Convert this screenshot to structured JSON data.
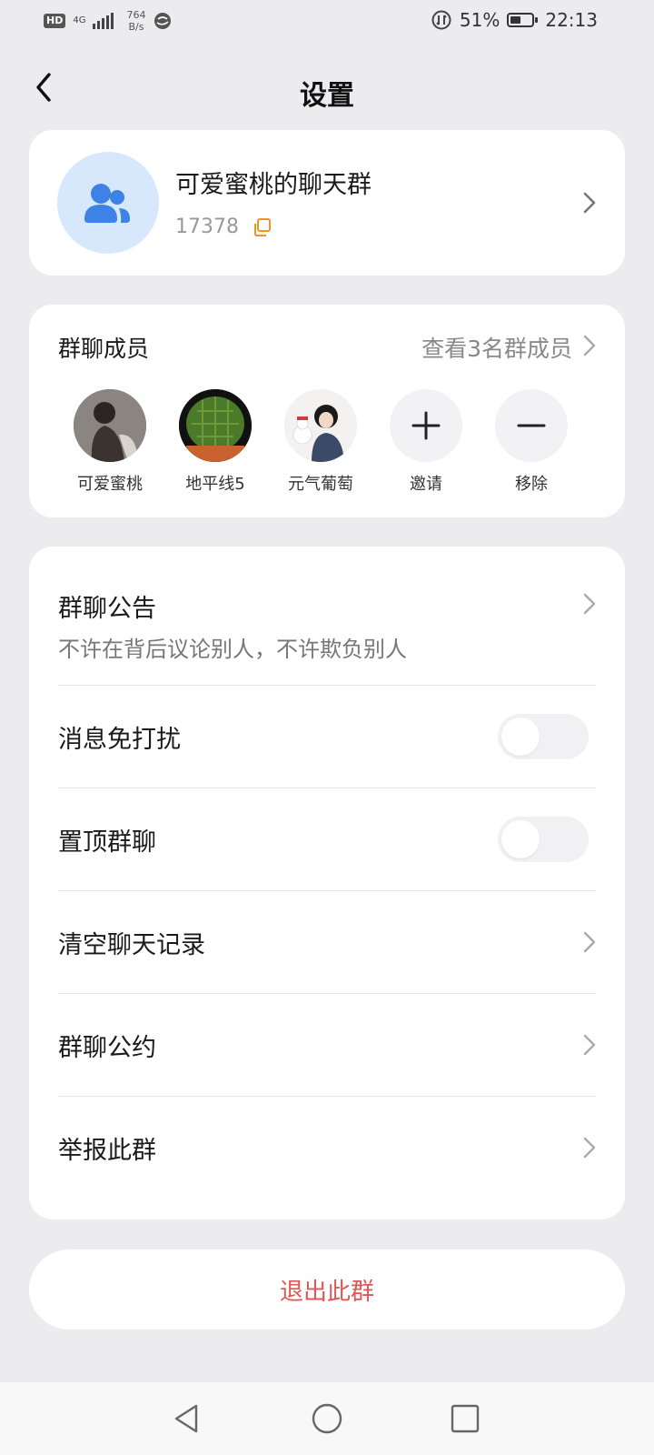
{
  "status_bar": {
    "hd": "HD",
    "network": "4G",
    "speed_value": "764",
    "speed_unit": "B/s",
    "battery": "51%",
    "battery_level": 0.51,
    "time": "22:13"
  },
  "nav": {
    "title": "设置"
  },
  "group": {
    "name": "可爱蜜桃的聊天群",
    "id": "17378"
  },
  "members": {
    "title": "群聊成员",
    "view_all": "查看3名群成员",
    "list": [
      {
        "name": "可爱蜜桃"
      },
      {
        "name": "地平线5"
      },
      {
        "name": "元气葡萄"
      }
    ],
    "invite_label": "邀请",
    "remove_label": "移除"
  },
  "settings": {
    "announcement_label": "群聊公告",
    "announcement_text": "不许在背后议论别人，不许欺负别人",
    "mute_label": "消息免打扰",
    "mute_on": false,
    "pin_label": "置顶群聊",
    "pin_on": false,
    "clear_label": "清空聊天记录",
    "rules_label": "群聊公约",
    "report_label": "举报此群"
  },
  "exit_label": "退出此群",
  "colors": {
    "accent_red": "#e05555",
    "avatar_bg": "#d8e8fc",
    "avatar_icon": "#3d82e6",
    "copy_icon": "#f0932b"
  }
}
